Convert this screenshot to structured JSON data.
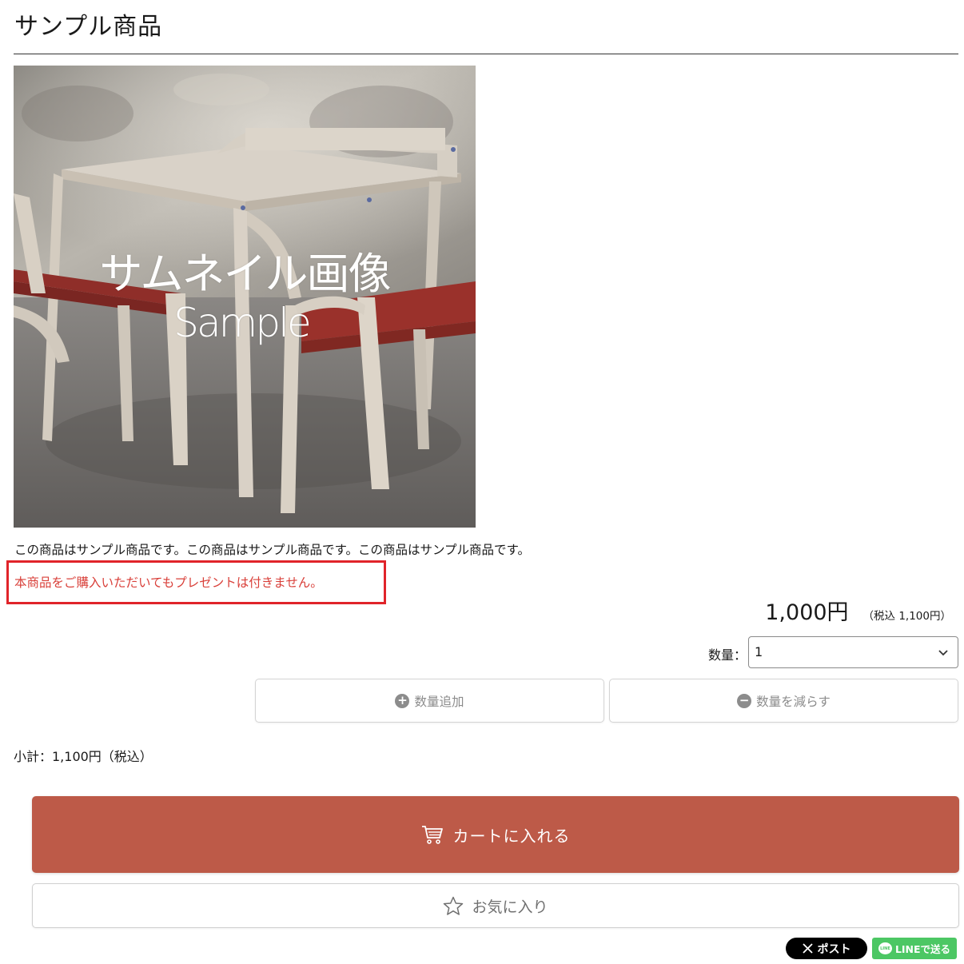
{
  "product": {
    "title": "サンプル商品",
    "image_overlay_line1": "サムネイル画像",
    "image_overlay_line2": "Sample",
    "description": "この商品はサンプル商品です。この商品はサンプル商品です。この商品はサンプル商品です。",
    "notice": "本商品をご購入いただいてもプレゼントは付きません。"
  },
  "price": {
    "main": "1,000円",
    "tax_included": "（税込 1,100円）"
  },
  "quantity": {
    "label": "数量：",
    "selected": "1",
    "add_label": "数量追加",
    "reduce_label": "数量を減らす"
  },
  "subtotal": "小計：1,100円（税込）",
  "actions": {
    "cart_label": "カートに入れる",
    "favorite_label": "お気に入り"
  },
  "share": {
    "x_label": "ポスト",
    "line_label": "LINEで送る",
    "line_icon_text": "LINE"
  },
  "colors": {
    "cart_button": "#bd5a48",
    "notice_text": "#d9403a",
    "notice_border": "#e0242a",
    "line_green": "#4cc764"
  }
}
